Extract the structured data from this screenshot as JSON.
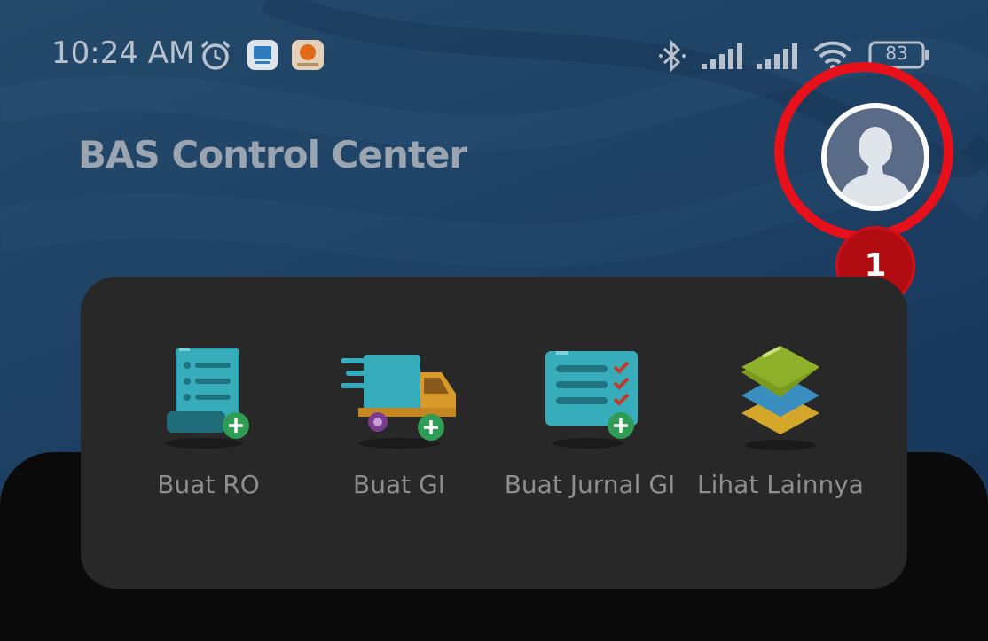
{
  "status_bar": {
    "time": "10:24 AM",
    "battery": "83",
    "icons": [
      "alarm-icon",
      "app-notification-icon",
      "app-notification-icon",
      "bluetooth-icon",
      "signal-icon",
      "signal-icon",
      "wifi-icon",
      "battery-icon"
    ]
  },
  "header": {
    "title": "BAS Control Center"
  },
  "profile": {
    "icon": "user-avatar-icon",
    "step_number": "1",
    "highlight_color": "#e8101a"
  },
  "quick_actions": [
    {
      "label": "Buat RO",
      "icon": "document-add-icon"
    },
    {
      "label": "Buat GI",
      "icon": "truck-add-icon"
    },
    {
      "label": "Buat Jurnal GI",
      "icon": "checklist-add-icon"
    },
    {
      "label": "Lihat Lainnya",
      "icon": "layers-icon"
    }
  ],
  "colors": {
    "header_bg": "#1f4366",
    "card_bg": "#282828",
    "sheet_bg": "#0a0a0a",
    "label_text": "#8e8e8e",
    "badge": "#b00c12"
  }
}
